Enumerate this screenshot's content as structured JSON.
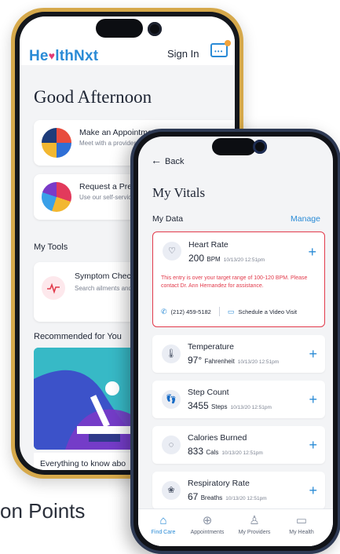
{
  "background": {
    "partial_text": "on Points"
  },
  "back_phone": {
    "logo": "He♥lthNxt",
    "sign_in": "Sign In",
    "greeting": "Good Afternoon",
    "cards": [
      {
        "title": "Make an Appointment",
        "sub": "Meet with a provider that in-person or virtually."
      },
      {
        "title": "Request a Prescr",
        "sub": "Use our self-service requests."
      }
    ],
    "tools_title": "My Tools",
    "symptom": {
      "title": "Symptom Checker",
      "sub": "Search ailments and to start feeling bette"
    },
    "recommended_title": "Recommended for You",
    "article_title": "Everything to know abo"
  },
  "front_phone": {
    "back_label": "Back",
    "title": "My Vitals",
    "data_label": "My Data",
    "manage_label": "Manage",
    "heart": {
      "name": "Heart Rate",
      "value": "200",
      "unit": "BPM",
      "timestamp": "10/13/20 12:51pm",
      "warning": "This entry is over your target range of 100-120 BPM. Please contact Dr. Ann Hernandez for assistance.",
      "phone": "(212) 459-5182",
      "video_label": "Schedule a Video Visit"
    },
    "vitals": [
      {
        "name": "Temperature",
        "value": "97°",
        "unit": "Fahrenheit",
        "timestamp": "10/13/20 12:51pm",
        "icon": "thermometer-icon",
        "glyph": "🌡"
      },
      {
        "name": "Step Count",
        "value": "3455",
        "unit": "Steps",
        "timestamp": "10/13/20 12:51pm",
        "icon": "footprints-icon",
        "glyph": "👣"
      },
      {
        "name": "Calories Burned",
        "value": "833",
        "unit": "Cals",
        "timestamp": "10/13/20 12:51pm",
        "icon": "flame-icon",
        "glyph": "◌"
      },
      {
        "name": "Respiratory Rate",
        "value": "67",
        "unit": "Breaths",
        "timestamp": "10/13/20 12:51pm",
        "icon": "lungs-icon",
        "glyph": "❀"
      }
    ],
    "tabs": [
      {
        "label": "Find Care",
        "icon": "home-icon",
        "glyph": "⌂",
        "active": true
      },
      {
        "label": "Appointments",
        "icon": "calendar-plus-icon",
        "glyph": "⊕",
        "active": false
      },
      {
        "label": "My Providers",
        "icon": "people-icon",
        "glyph": "♙",
        "active": false
      },
      {
        "label": "My Health",
        "icon": "clipboard-icon",
        "glyph": "▭",
        "active": false
      }
    ]
  },
  "colors": {
    "brand_blue": "#2a8bd6",
    "alert_red": "#e23a4b",
    "brand_pink": "#e23a77",
    "gold_frame": "#d6a94b"
  }
}
